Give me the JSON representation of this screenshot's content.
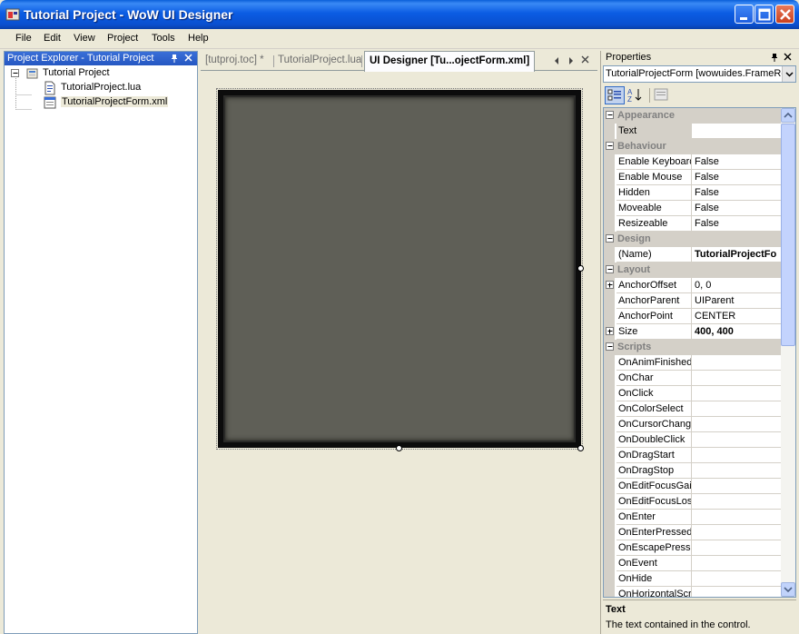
{
  "window": {
    "title": "Tutorial Project - WoW UI Designer",
    "colors": {
      "titlebar": "#0b5ce3",
      "close": "#c9401e"
    }
  },
  "menu": [
    "File",
    "Edit",
    "View",
    "Project",
    "Tools",
    "Help"
  ],
  "explorer": {
    "title": "Project Explorer - Tutorial Project",
    "tree": [
      {
        "label": "Tutorial Project",
        "icon": "project-icon",
        "selected": false
      },
      {
        "label": "TutorialProject.lua",
        "icon": "lua-file-icon",
        "selected": false
      },
      {
        "label": "TutorialProjectForm.xml",
        "icon": "xml-form-icon",
        "selected": true
      }
    ]
  },
  "tabs": [
    {
      "label": "[tutproj.toc] *",
      "active": false
    },
    {
      "label": "TutorialProject.lua",
      "active": false
    },
    {
      "label": "UI Designer [Tu...ojectForm.xml]",
      "active": true
    }
  ],
  "designer": {
    "frame_color": "#5f5f57"
  },
  "properties": {
    "title": "Properties",
    "selected_object": "TutorialProjectForm [wowuides.FrameRe",
    "categories": [
      {
        "name": "Appearance",
        "rows": [
          {
            "name": "Text",
            "value": "",
            "selected": true
          }
        ]
      },
      {
        "name": "Behaviour",
        "rows": [
          {
            "name": "Enable Keyboard",
            "value": "False"
          },
          {
            "name": "Enable Mouse",
            "value": "False"
          },
          {
            "name": "Hidden",
            "value": "False"
          },
          {
            "name": "Moveable",
            "value": "False"
          },
          {
            "name": "Resizeable",
            "value": "False"
          }
        ]
      },
      {
        "name": "Design",
        "rows": [
          {
            "name": "(Name)",
            "value": "TutorialProjectFo",
            "bold": true
          }
        ]
      },
      {
        "name": "Layout",
        "rows": [
          {
            "name": "AnchorOffset",
            "value": "0, 0",
            "expandable": true
          },
          {
            "name": "AnchorParent",
            "value": "UIParent"
          },
          {
            "name": "AnchorPoint",
            "value": "CENTER"
          },
          {
            "name": "Size",
            "value": "400, 400",
            "expandable": true,
            "bold": true
          }
        ]
      },
      {
        "name": "Scripts",
        "rows": [
          {
            "name": "OnAnimFinished",
            "value": ""
          },
          {
            "name": "OnChar",
            "value": ""
          },
          {
            "name": "OnClick",
            "value": ""
          },
          {
            "name": "OnColorSelect",
            "value": ""
          },
          {
            "name": "OnCursorChange",
            "value": ""
          },
          {
            "name": "OnDoubleClick",
            "value": ""
          },
          {
            "name": "OnDragStart",
            "value": ""
          },
          {
            "name": "OnDragStop",
            "value": ""
          },
          {
            "name": "OnEditFocusGain",
            "value": ""
          },
          {
            "name": "OnEditFocusLost",
            "value": ""
          },
          {
            "name": "OnEnter",
            "value": ""
          },
          {
            "name": "OnEnterPressed",
            "value": ""
          },
          {
            "name": "OnEscapePresse",
            "value": ""
          },
          {
            "name": "OnEvent",
            "value": ""
          },
          {
            "name": "OnHide",
            "value": ""
          },
          {
            "name": "OnHorizontalScro",
            "value": ""
          }
        ]
      }
    ],
    "description": {
      "title": "Text",
      "text": "The text contained in the control."
    }
  }
}
